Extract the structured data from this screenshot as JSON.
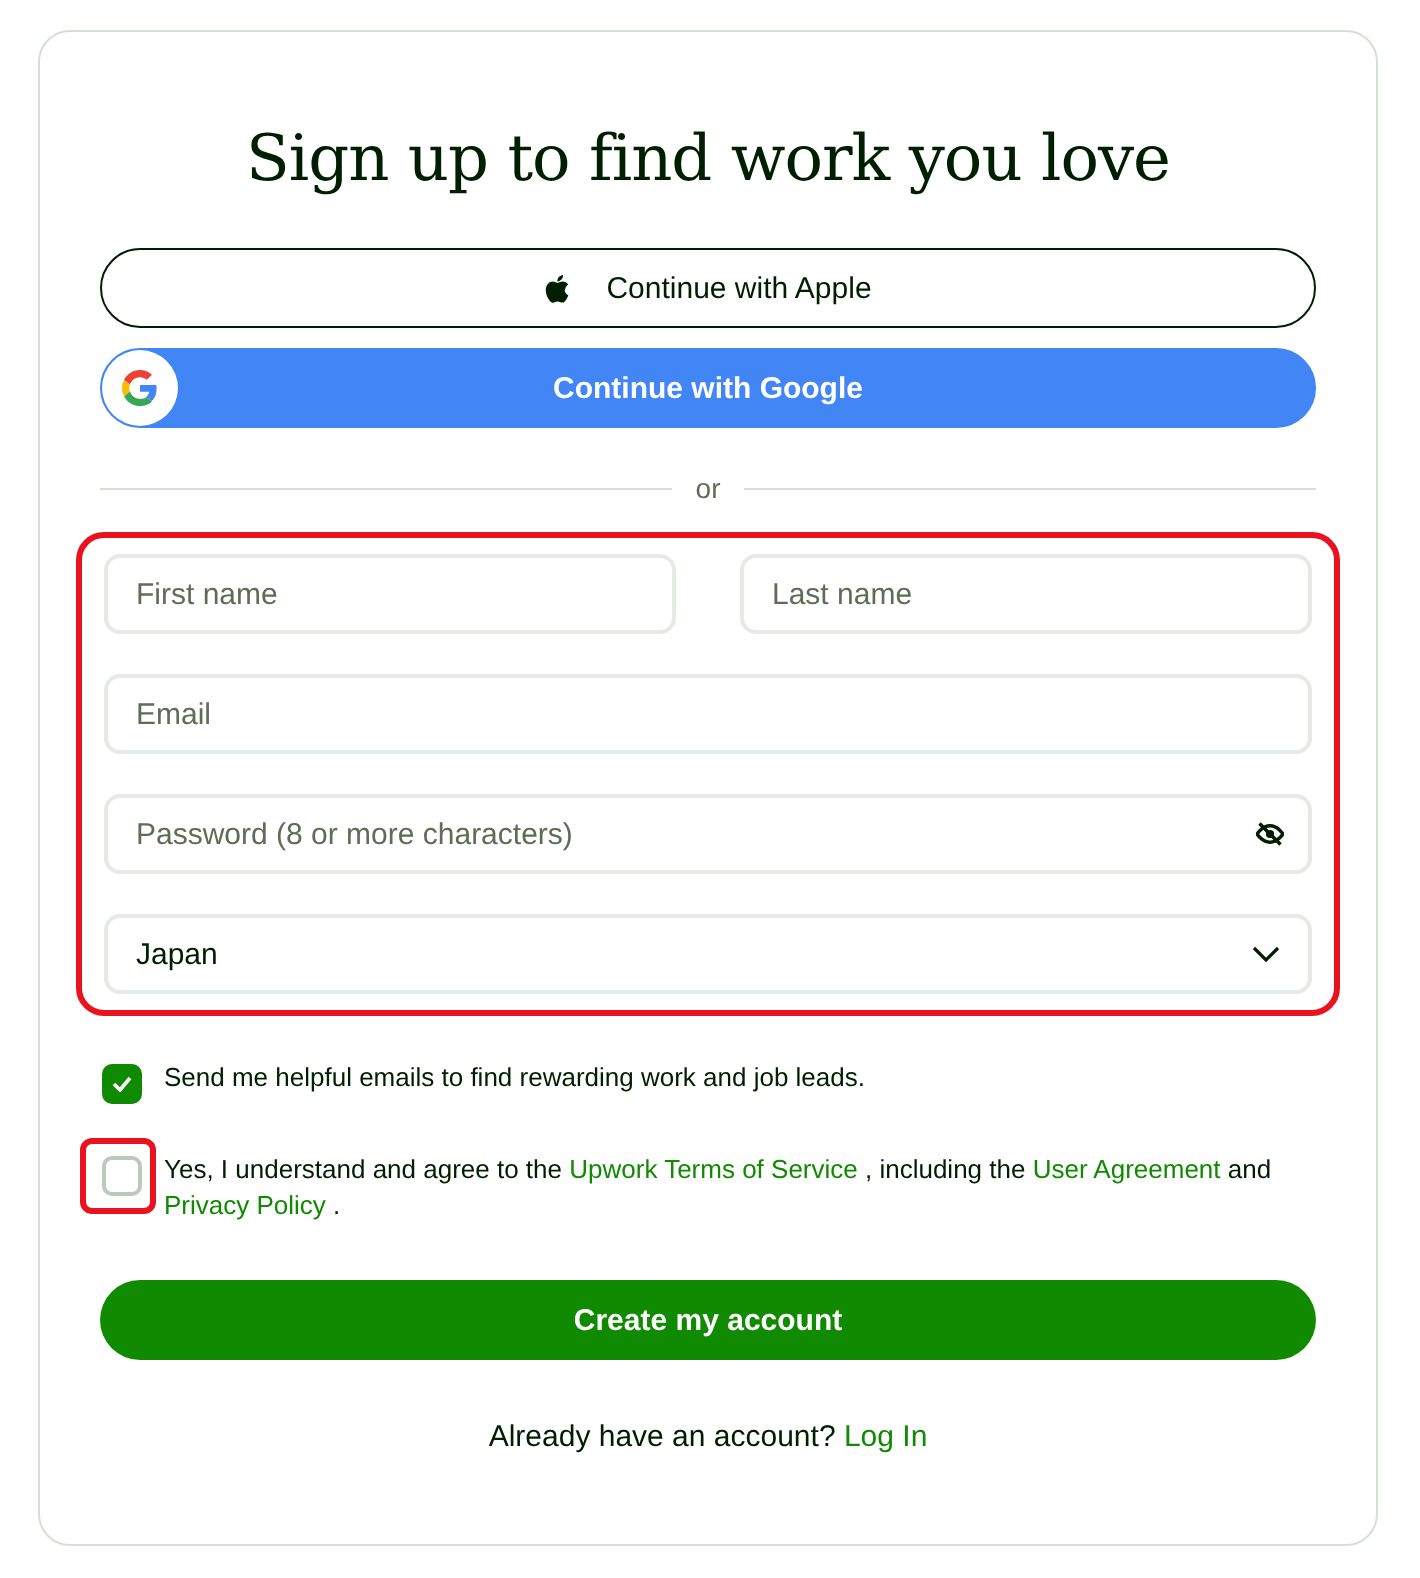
{
  "title": "Sign up to find work you love",
  "social_buttons": [
    {
      "kind": "apple",
      "label": "Continue with Apple"
    },
    {
      "kind": "google",
      "label": "Continue with Google"
    }
  ],
  "divider": "or",
  "form": {
    "highlighted": true,
    "name_fields": [
      {
        "placeholder": "First name"
      },
      {
        "placeholder": "Last name"
      }
    ],
    "email": {
      "placeholder": "Email"
    },
    "password": {
      "placeholder": "Password (8 or more characters)"
    },
    "country": {
      "value": "Japan"
    }
  },
  "options": [
    {
      "checked": true,
      "highlighted": false,
      "parts": [
        {
          "kind": "text",
          "text": "Send me helpful emails to find rewarding work and job leads."
        }
      ]
    },
    {
      "checked": false,
      "highlighted": true,
      "parts": [
        {
          "kind": "text",
          "text": "Yes, I understand and agree to the "
        },
        {
          "kind": "link",
          "text": "Upwork Terms of Service"
        },
        {
          "kind": "text",
          "text": " , including the "
        },
        {
          "kind": "link",
          "text": "User Agreement"
        },
        {
          "kind": "text",
          "text": " and "
        },
        {
          "kind": "link",
          "text": "Privacy Policy"
        },
        {
          "kind": "text",
          "text": " ."
        }
      ]
    }
  ],
  "submit": "Create my account",
  "login": {
    "prompt": "Already have an account?",
    "link": "Log In"
  }
}
